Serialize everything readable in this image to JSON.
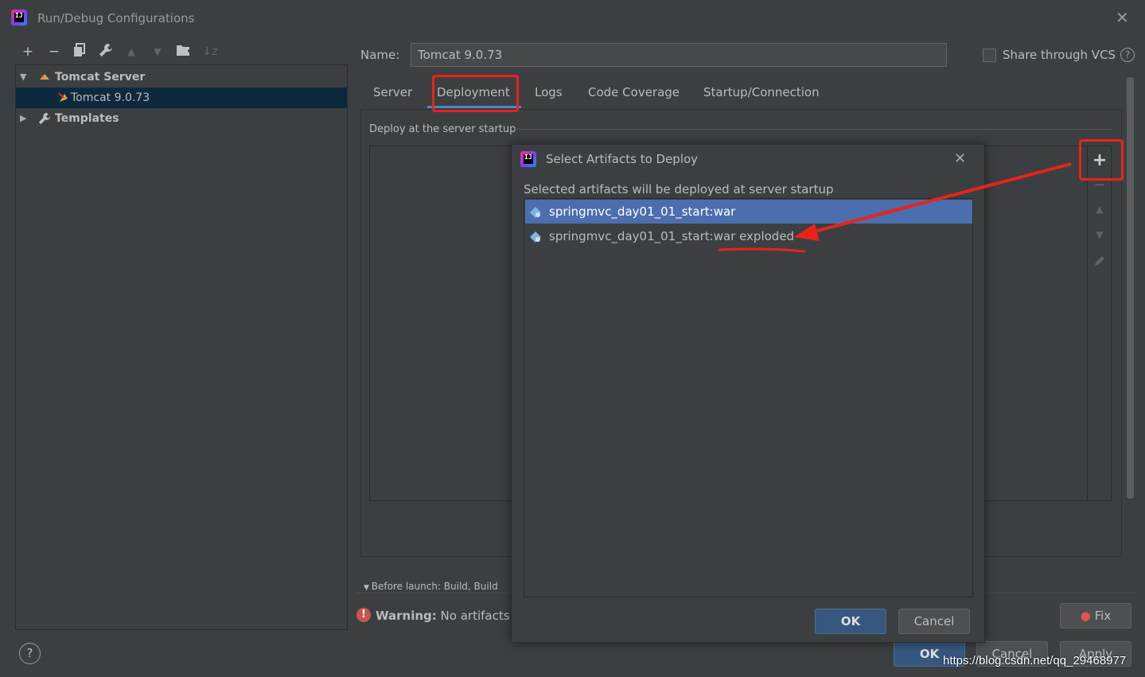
{
  "window": {
    "title": "Run/Debug Configurations",
    "close_glyph": "✕"
  },
  "toolbar": {
    "icons": [
      "add-icon",
      "remove-icon",
      "copy-icon",
      "wrench-icon",
      "move-up-icon",
      "move-down-icon",
      "folder-add-icon",
      "sort-icon"
    ]
  },
  "tree": {
    "items": [
      {
        "label": "Tomcat Server",
        "arrow": "▼"
      },
      {
        "label": "Tomcat 9.0.73"
      },
      {
        "label": "Templates",
        "arrow": "▶"
      }
    ]
  },
  "form": {
    "name_label": "Name:",
    "name_value": "Tomcat 9.0.73",
    "share_label": "Share through VCS",
    "help_glyph": "?"
  },
  "tabs": [
    {
      "label": "Server"
    },
    {
      "label": "Deployment"
    },
    {
      "label": "Logs"
    },
    {
      "label": "Code Coverage"
    },
    {
      "label": "Startup/Connection"
    }
  ],
  "deployment": {
    "section_label": "Deploy at the server startup",
    "before_launch": "Before launch: Build, Build"
  },
  "warning": {
    "label": "Warning:",
    "text": "No artifacts m"
  },
  "buttons": {
    "fix": "Fix",
    "ok": "OK",
    "cancel": "Cancel",
    "apply": "Apply",
    "help": "?"
  },
  "modal": {
    "title": "Select Artifacts to Deploy",
    "description": "Selected artifacts will be deployed at server startup",
    "artifacts": [
      {
        "label": "springmvc_day01_01_start:war"
      },
      {
        "label": "springmvc_day01_01_start:war exploded"
      }
    ],
    "ok": "OK",
    "cancel": "Cancel"
  },
  "watermark": "https://blog.csdn.net/qq_29468977",
  "colors": {
    "background": "#3c3f41",
    "selection": "#4b6eaf",
    "tree_selection": "#0d293e",
    "primary_button": "#365880",
    "annotation": "#e8241a",
    "tab_underline": "#4a88c7"
  }
}
